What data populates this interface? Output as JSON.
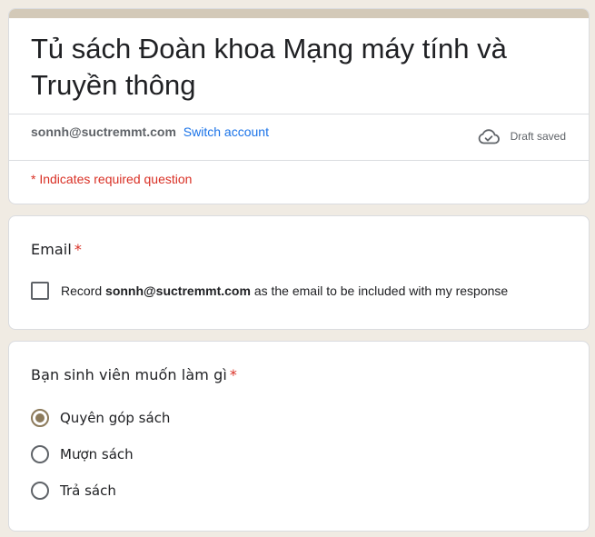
{
  "form": {
    "title": "Tủ sách Đoàn khoa Mạng máy tính và Truyền thông",
    "account_email": "sonnh@suctremmt.com",
    "switch_account_label": "Switch account",
    "draft_status": "Draft saved",
    "required_note": "* Indicates required question"
  },
  "icons": {
    "draft": "cloud-check-icon"
  },
  "colors": {
    "accent": "#8c7a5b",
    "header_stripe": "#d3c9b8",
    "background": "#f0ebe3",
    "required": "#d93025",
    "link": "#1a73e8"
  },
  "questions": [
    {
      "title": "Email",
      "required_mark": "*",
      "checkbox": {
        "prefix": "Record",
        "email": "sonnh@suctremmt.com",
        "suffix": "as the email to be included with my response",
        "checked": false
      }
    },
    {
      "title": "Bạn sinh viên muốn làm gì",
      "required_mark": "*",
      "options": [
        {
          "label": "Quyên góp sách",
          "selected": true
        },
        {
          "label": "Mượn sách",
          "selected": false
        },
        {
          "label": "Trả sách",
          "selected": false
        }
      ]
    }
  ]
}
